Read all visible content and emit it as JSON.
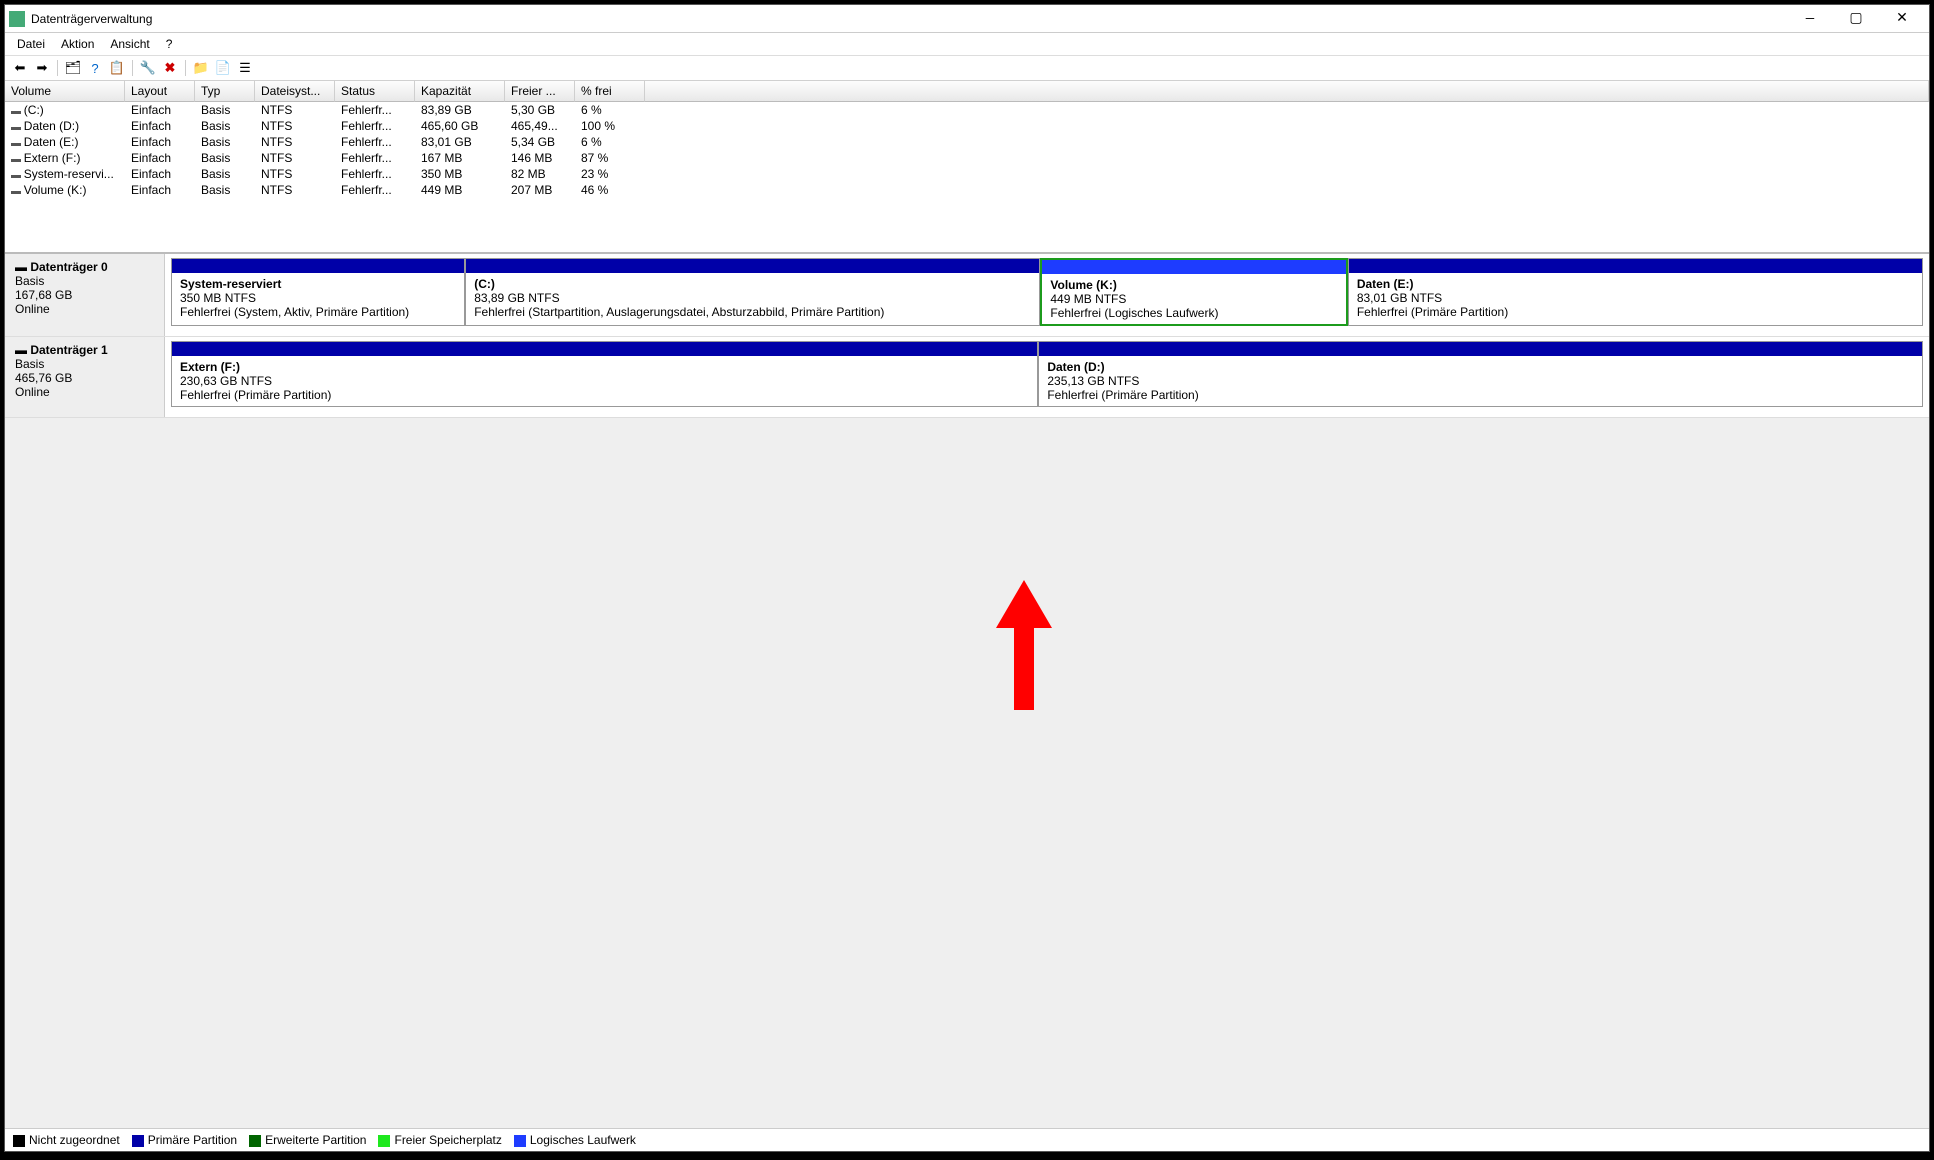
{
  "window": {
    "title": "Datenträgerverwaltung"
  },
  "menu": {
    "datei": "Datei",
    "aktion": "Aktion",
    "ansicht": "Ansicht",
    "help": "?"
  },
  "columns": {
    "volume": "Volume",
    "layout": "Layout",
    "typ": "Typ",
    "dateisys": "Dateisyst...",
    "status": "Status",
    "kap": "Kapazität",
    "frei": "Freier ...",
    "pfrei": "% frei"
  },
  "volumes": [
    {
      "name": "(C:)",
      "layout": "Einfach",
      "typ": "Basis",
      "fs": "NTFS",
      "status": "Fehlerfr...",
      "kap": "83,89 GB",
      "frei": "5,30 GB",
      "pfrei": "6 %"
    },
    {
      "name": "Daten (D:)",
      "layout": "Einfach",
      "typ": "Basis",
      "fs": "NTFS",
      "status": "Fehlerfr...",
      "kap": "465,60 GB",
      "frei": "465,49...",
      "pfrei": "100 %"
    },
    {
      "name": "Daten (E:)",
      "layout": "Einfach",
      "typ": "Basis",
      "fs": "NTFS",
      "status": "Fehlerfr...",
      "kap": "83,01 GB",
      "frei": "5,34 GB",
      "pfrei": "6 %"
    },
    {
      "name": "Extern (F:)",
      "layout": "Einfach",
      "typ": "Basis",
      "fs": "NTFS",
      "status": "Fehlerfr...",
      "kap": "167 MB",
      "frei": "146 MB",
      "pfrei": "87 %"
    },
    {
      "name": "System-reservi...",
      "layout": "Einfach",
      "typ": "Basis",
      "fs": "NTFS",
      "status": "Fehlerfr...",
      "kap": "350 MB",
      "frei": "82 MB",
      "pfrei": "23 %"
    },
    {
      "name": "Volume (K:)",
      "layout": "Einfach",
      "typ": "Basis",
      "fs": "NTFS",
      "status": "Fehlerfr...",
      "kap": "449 MB",
      "frei": "207 MB",
      "pfrei": "46 %"
    }
  ],
  "disks": [
    {
      "title": "Datenträger 0",
      "basis": "Basis",
      "size": "167,68 GB",
      "state": "Online",
      "parts": [
        {
          "name": "System-reserviert",
          "size": "350 MB NTFS",
          "status": "Fehlerfrei (System, Aktiv, Primäre Partition)",
          "bar": "primary",
          "grow": 2.6,
          "selected": false
        },
        {
          "name": " (C:)",
          "size": "83,89 GB NTFS",
          "status": "Fehlerfrei (Startpartition, Auslagerungsdatei, Absturzabbild, Primäre Partition)",
          "bar": "primary",
          "grow": 5.1,
          "selected": false
        },
        {
          "name": "Volume  (K:)",
          "size": "449 MB NTFS",
          "status": "Fehlerfrei (Logisches Laufwerk)",
          "bar": "logical",
          "grow": 2.7,
          "selected": true
        },
        {
          "name": "Daten  (E:)",
          "size": "83,01 GB NTFS",
          "status": "Fehlerfrei (Primäre Partition)",
          "bar": "primary",
          "grow": 5.1,
          "selected": false
        }
      ]
    },
    {
      "title": "Datenträger 1",
      "basis": "Basis",
      "size": "465,76 GB",
      "state": "Online",
      "parts": [
        {
          "name": "Extern  (F:)",
          "size": "230,63 GB NTFS",
          "status": "Fehlerfrei (Primäre Partition)",
          "bar": "primary",
          "grow": 1,
          "selected": false
        },
        {
          "name": "Daten  (D:)",
          "size": "235,13 GB NTFS",
          "status": "Fehlerfrei (Primäre Partition)",
          "bar": "primary",
          "grow": 1.02,
          "selected": false
        }
      ]
    }
  ],
  "legend": {
    "unalloc": "Nicht zugeordnet",
    "primary": "Primäre Partition",
    "extended": "Erweiterte Partition",
    "free": "Freier Speicherplatz",
    "logical": "Logisches Laufwerk"
  }
}
